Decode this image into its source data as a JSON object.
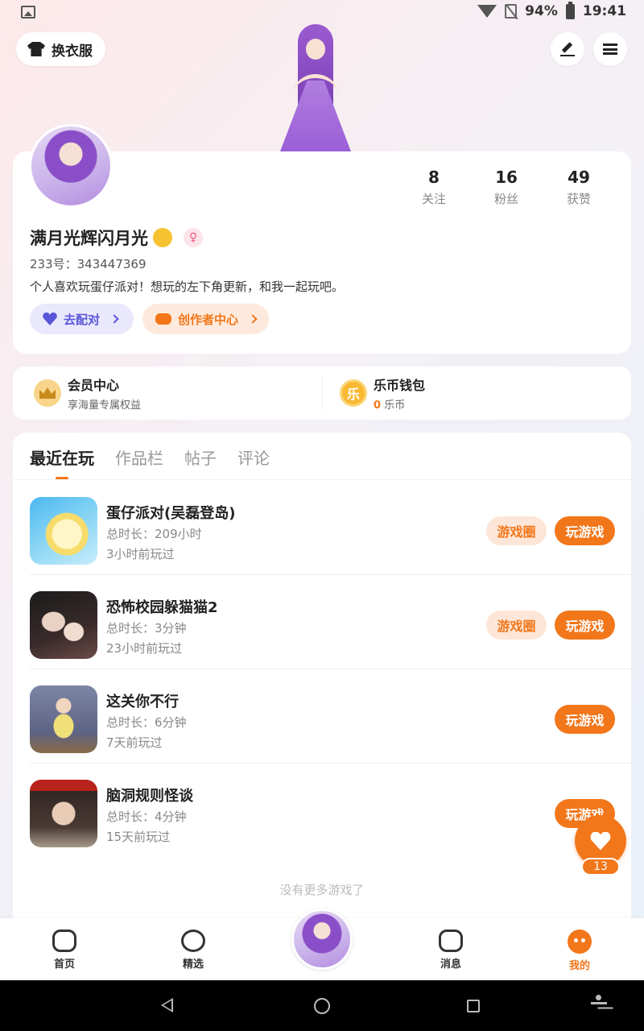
{
  "status_bar": {
    "battery": "94%",
    "time": "19:41"
  },
  "header": {
    "outfit_label": "换衣服"
  },
  "profile": {
    "stats": [
      {
        "value": "8",
        "label": "关注"
      },
      {
        "value": "16",
        "label": "粉丝"
      },
      {
        "value": "49",
        "label": "获赞"
      }
    ],
    "username": "满月光辉闪月光",
    "user_id": "233号：343447369",
    "bio": "个人喜欢玩蛋仔派对！想玩的左下角更新，和我一起玩吧。",
    "pair_label": "去配对",
    "creator_label": "创作者中心"
  },
  "member": {
    "title": "会员中心",
    "subtitle": "享海量专属权益"
  },
  "wallet": {
    "title": "乐币钱包",
    "icon_text": "乐",
    "amount": "0",
    "unit": "乐币"
  },
  "tabs": [
    "最近在玩",
    "作品栏",
    "帖子",
    "评论"
  ],
  "games": [
    {
      "name": "蛋仔派对(吴磊登岛)",
      "duration": "总时长：209小时",
      "last_played": "3小时前玩过",
      "circle_label": "游戏圈",
      "play_label": "玩游戏"
    },
    {
      "name": "恐怖校园躲猫猫2",
      "duration": "总时长：3分钟",
      "last_played": "23小时前玩过",
      "circle_label": "游戏圈",
      "play_label": "玩游戏"
    },
    {
      "name": "这关你不行",
      "duration": "总时长：6分钟",
      "last_played": "7天前玩过",
      "play_label": "玩游戏"
    },
    {
      "name": "脑洞规则怪谈",
      "duration": "总时长：4分钟",
      "last_played": "15天前玩过",
      "play_label": "玩游戏"
    }
  ],
  "list_footer": "没有更多游戏了",
  "like": {
    "count": "13"
  },
  "bottom_nav": {
    "home": "首页",
    "featured": "精选",
    "messages": "消息",
    "me": "我的"
  },
  "colors": {
    "accent": "#f2761a",
    "pair": "#5a56d8"
  },
  "icons": [
    "image-icon",
    "wifi-icon",
    "no-sim-icon",
    "battery-icon",
    "shirt-icon",
    "edit-icon",
    "menu-icon",
    "crown-icon",
    "heart-icon",
    "gamepad-icon"
  ]
}
